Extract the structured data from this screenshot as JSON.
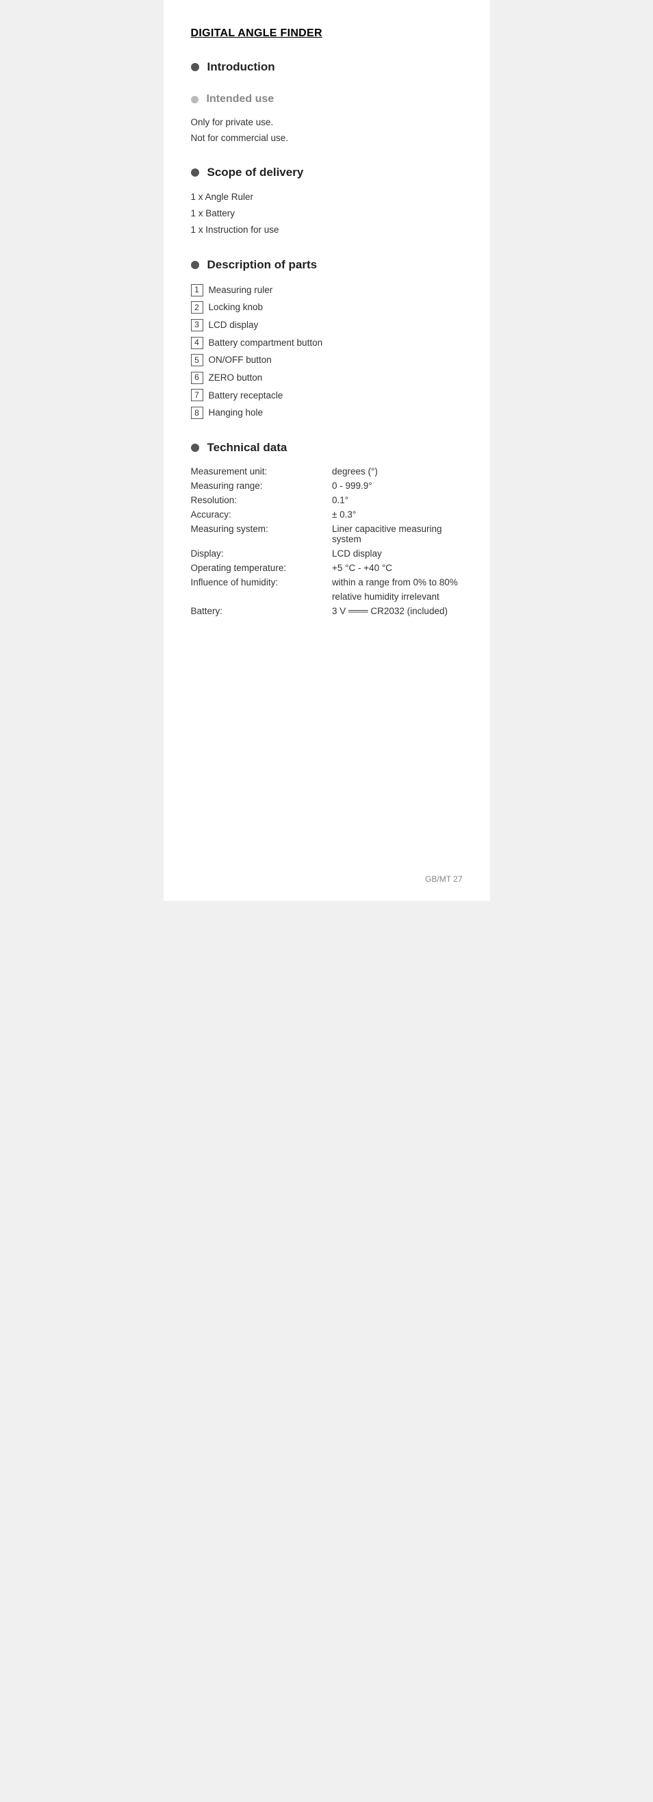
{
  "page": {
    "main_title": "DIGITAL ANGLE FINDER",
    "footer": "GB/MT  27"
  },
  "introduction": {
    "title": "Introduction"
  },
  "intended_use": {
    "title": "Intended use",
    "lines": [
      "Only for private use.",
      "Not for commercial use."
    ]
  },
  "scope_of_delivery": {
    "title": "Scope of delivery",
    "items": [
      "1 x Angle Ruler",
      "1 x Battery",
      "1 x Instruction for use"
    ]
  },
  "description_of_parts": {
    "title": "Description of parts",
    "parts": [
      {
        "number": "1",
        "label": "Measuring ruler"
      },
      {
        "number": "2",
        "label": "Locking knob"
      },
      {
        "number": "3",
        "label": "LCD display"
      },
      {
        "number": "4",
        "label": "Battery compartment button"
      },
      {
        "number": "5",
        "label": "ON/OFF button"
      },
      {
        "number": "6",
        "label": "ZERO button"
      },
      {
        "number": "7",
        "label": "Battery receptacle"
      },
      {
        "number": "8",
        "label": "Hanging hole"
      }
    ]
  },
  "technical_data": {
    "title": "Technical data",
    "rows": [
      {
        "label": "Measurement unit:",
        "value": "degrees (°)"
      },
      {
        "label": "Measuring range:",
        "value": "0 - 999.9°"
      },
      {
        "label": "Resolution:",
        "value": "0.1°"
      },
      {
        "label": "Accuracy:",
        "value": "± 0.3°"
      },
      {
        "label": "Measuring system:",
        "value": "Liner capacitive measuring system"
      },
      {
        "label": "Display:",
        "value": "LCD display"
      },
      {
        "label": "Operating temperature:",
        "value": "+5 °C - +40 °C"
      },
      {
        "label": "Influence of humidity:",
        "value": "within a range from 0% to 80%"
      },
      {
        "label": "",
        "value": "relative humidity irrelevant"
      },
      {
        "label": "Battery:",
        "value": "3 V ═══ CR2032 (included)"
      }
    ]
  }
}
